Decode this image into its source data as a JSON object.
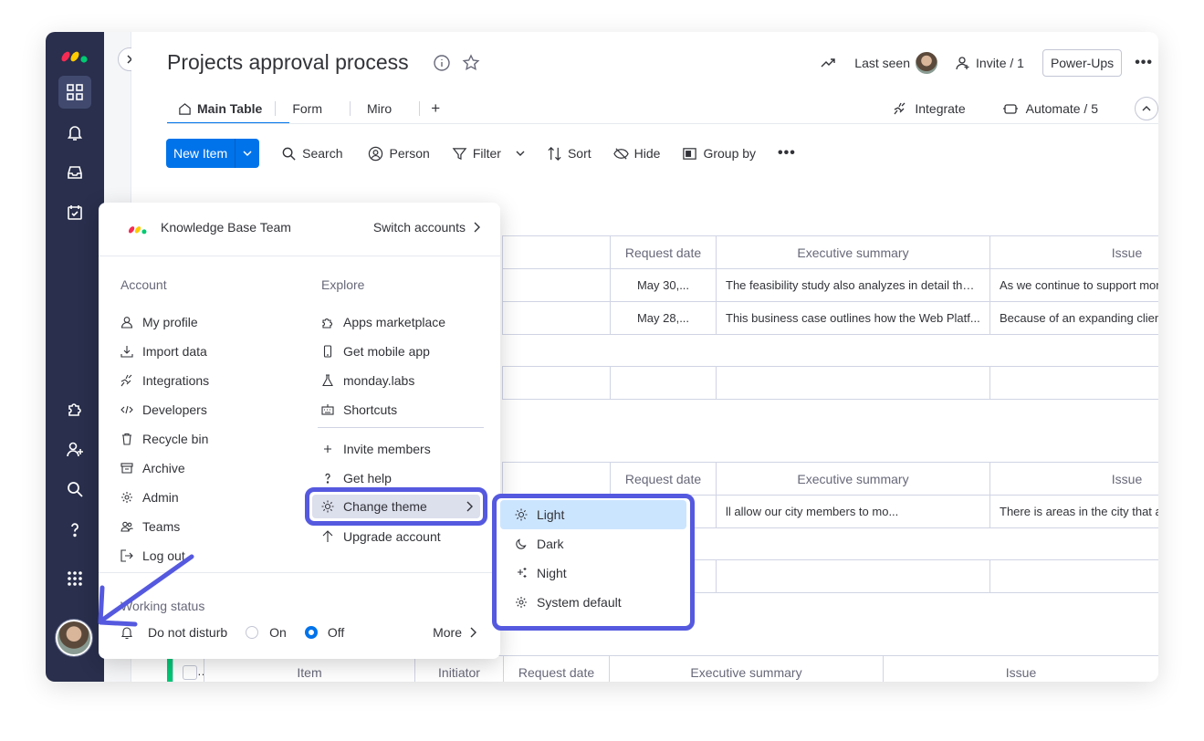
{
  "board": {
    "title": "Projects approval process",
    "last_seen": "Last seen",
    "invite": "Invite / 1",
    "power_ups": "Power-Ups"
  },
  "tabs": [
    {
      "label": "Main Table"
    },
    {
      "label": "Form"
    },
    {
      "label": "Miro"
    }
  ],
  "tabs_right": {
    "integrate": "Integrate",
    "automate": "Automate / 5"
  },
  "toolbar": {
    "new_item": "New Item",
    "search": "Search",
    "person": "Person",
    "filter": "Filter",
    "sort": "Sort",
    "hide": "Hide",
    "group_by": "Group by"
  },
  "table": {
    "headers": {
      "item": "Item",
      "initiator": "Initiator",
      "request_date": "Request date",
      "executive_summary": "Executive summary",
      "issue": "Issue"
    },
    "group1_rows": [
      {
        "date": "May 30,...",
        "summary": "The feasibility study also analyzes in detail the ...",
        "issue": "As we continue to support more clients in mor..."
      },
      {
        "date": "May 28,...",
        "summary": "This business case outlines how the Web Platf...",
        "issue": "Because of an expanding client base, Smith Co..."
      }
    ],
    "group2_rows": [
      {
        "summary": "ll allow our city members to mo...",
        "issue": "There is areas in the city that are not appealing..."
      }
    ]
  },
  "menu": {
    "account_name": "Knowledge Base Team",
    "switch_accounts": "Switch accounts",
    "account_title": "Account",
    "account_items": [
      {
        "label": "My profile",
        "icon": "person-icon"
      },
      {
        "label": "Import data",
        "icon": "download-icon"
      },
      {
        "label": "Integrations",
        "icon": "plug-icon"
      },
      {
        "label": "Developers",
        "icon": "code-icon"
      },
      {
        "label": "Recycle bin",
        "icon": "trash-icon"
      },
      {
        "label": "Archive",
        "icon": "archive-icon"
      },
      {
        "label": "Admin",
        "icon": "gear-icon"
      },
      {
        "label": "Teams",
        "icon": "team-icon"
      },
      {
        "label": "Log out",
        "icon": "logout-icon"
      }
    ],
    "explore_title": "Explore",
    "explore_items": [
      {
        "label": "Apps marketplace",
        "icon": "puzzle-icon"
      },
      {
        "label": "Get mobile app",
        "icon": "mobile-icon"
      },
      {
        "label": "monday.labs",
        "icon": "flask-icon"
      },
      {
        "label": "Shortcuts",
        "icon": "keyboard-icon"
      }
    ],
    "explore_items2": [
      {
        "label": "Invite members",
        "icon": "plus-icon"
      },
      {
        "label": "Get help",
        "icon": "question-icon"
      }
    ],
    "change_theme": "Change theme",
    "upgrade": "Upgrade account",
    "working_status": "Working status",
    "do_not_disturb": "Do not disturb",
    "on": "On",
    "off": "Off",
    "more": "More"
  },
  "theme_menu": {
    "items": [
      {
        "label": "Light",
        "icon": "sun-icon",
        "selected": true
      },
      {
        "label": "Dark",
        "icon": "moon-icon",
        "selected": false
      },
      {
        "label": "Night",
        "icon": "sparkle-icon",
        "selected": false
      },
      {
        "label": "System default",
        "icon": "gear-icon",
        "selected": false
      }
    ]
  },
  "colors": {
    "nav_bg": "#292f4c",
    "primary": "#0073ea",
    "highlight": "#5559df",
    "group_green": "#00c875",
    "selected_theme_bg": "#cce5ff"
  }
}
